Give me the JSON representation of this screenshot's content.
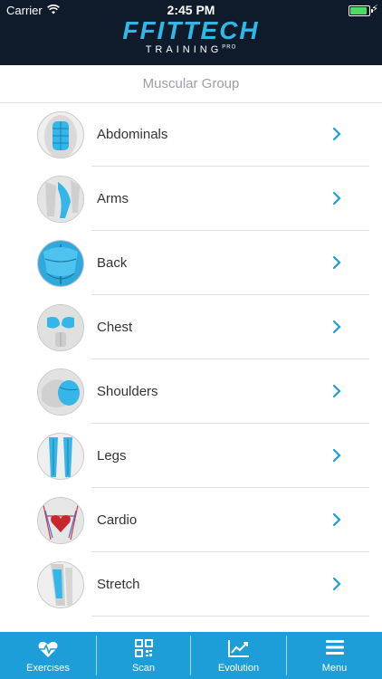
{
  "status_bar": {
    "carrier": "Carrier",
    "time": "2:45 PM"
  },
  "header": {
    "logo_main": "FFITTECH",
    "logo_sub": "TRAINING",
    "logo_sup": "PRO"
  },
  "section": {
    "title": "Muscular Group"
  },
  "groups": [
    {
      "label": "Abdominals",
      "icon": "abdominals-thumbnail"
    },
    {
      "label": "Arms",
      "icon": "arms-thumbnail"
    },
    {
      "label": "Back",
      "icon": "back-thumbnail"
    },
    {
      "label": "Chest",
      "icon": "chest-thumbnail"
    },
    {
      "label": "Shoulders",
      "icon": "shoulders-thumbnail"
    },
    {
      "label": "Legs",
      "icon": "legs-thumbnail"
    },
    {
      "label": "Cardio",
      "icon": "cardio-thumbnail"
    },
    {
      "label": "Stretch",
      "icon": "stretch-thumbnail"
    }
  ],
  "tabs": [
    {
      "label": "Exercises",
      "icon": "heart-pulse-icon"
    },
    {
      "label": "Scan",
      "icon": "qr-code-icon"
    },
    {
      "label": "Evolution",
      "icon": "trend-chart-icon"
    },
    {
      "label": "Menu",
      "icon": "hamburger-menu-icon"
    }
  ],
  "colors": {
    "header_bg": "#0f1a2b",
    "accent": "#1e9ed8",
    "muscle_blue": "#35b6e8"
  }
}
